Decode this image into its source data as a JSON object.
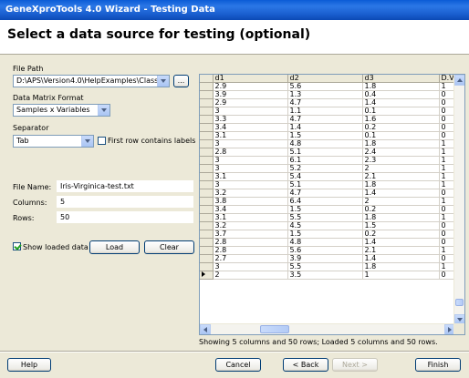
{
  "window": {
    "title": "GeneXproTools 4.0 Wizard - Testing Data"
  },
  "header": {
    "title": "Select a data source for testing (optional)"
  },
  "form": {
    "file_path_label": "File Path",
    "file_path_value": "D:\\APS\\Version4.0\\HelpExamples\\Classificatic",
    "browse_label": "...",
    "data_matrix_label": "Data Matrix Format",
    "data_matrix_value": "Samples x Variables",
    "separator_label": "Separator",
    "separator_value": "Tab",
    "first_row_label": "First row contains labels",
    "first_row_checked": false,
    "file_name_label": "File Name:",
    "file_name_value": "Iris-Virginica-test.txt",
    "columns_label": "Columns:",
    "columns_value": "5",
    "rows_label": "Rows:",
    "rows_value": "50",
    "show_loaded_label": "Show loaded data",
    "show_loaded_checked": true,
    "load_label": "Load",
    "clear_label": "Clear"
  },
  "grid": {
    "columns": [
      "d1",
      "d2",
      "d3",
      "D.V."
    ],
    "rows": [
      [
        "2.9",
        "5.6",
        "1.8",
        "1"
      ],
      [
        "3.9",
        "1.3",
        "0.4",
        "0"
      ],
      [
        "2.9",
        "4.7",
        "1.4",
        "0"
      ],
      [
        "3",
        "1.1",
        "0.1",
        "0"
      ],
      [
        "3.3",
        "4.7",
        "1.6",
        "0"
      ],
      [
        "3.4",
        "1.4",
        "0.2",
        "0"
      ],
      [
        "3.1",
        "1.5",
        "0.1",
        "0"
      ],
      [
        "3",
        "4.8",
        "1.8",
        "1"
      ],
      [
        "2.8",
        "5.1",
        "2.4",
        "1"
      ],
      [
        "3",
        "6.1",
        "2.3",
        "1"
      ],
      [
        "3",
        "5.2",
        "2",
        "1"
      ],
      [
        "3.1",
        "5.4",
        "2.1",
        "1"
      ],
      [
        "3",
        "5.1",
        "1.8",
        "1"
      ],
      [
        "3.2",
        "4.7",
        "1.4",
        "0"
      ],
      [
        "3.8",
        "6.4",
        "2",
        "1"
      ],
      [
        "3.4",
        "1.5",
        "0.2",
        "0"
      ],
      [
        "3.1",
        "5.5",
        "1.8",
        "1"
      ],
      [
        "3.2",
        "4.5",
        "1.5",
        "0"
      ],
      [
        "3.7",
        "1.5",
        "0.2",
        "0"
      ],
      [
        "2.8",
        "4.8",
        "1.4",
        "0"
      ],
      [
        "2.8",
        "5.6",
        "2.1",
        "1"
      ],
      [
        "2.7",
        "3.9",
        "1.4",
        "0"
      ],
      [
        "3",
        "5.5",
        "1.8",
        "1"
      ],
      [
        "2",
        "3.5",
        "1",
        "0"
      ]
    ],
    "status": "Showing 5 columns and 50 rows; Loaded 5 columns and 50 rows."
  },
  "footer": {
    "help_label": "Help",
    "cancel_label": "Cancel",
    "back_label": "< Back",
    "next_label": "Next >",
    "finish_label": "Finish"
  }
}
